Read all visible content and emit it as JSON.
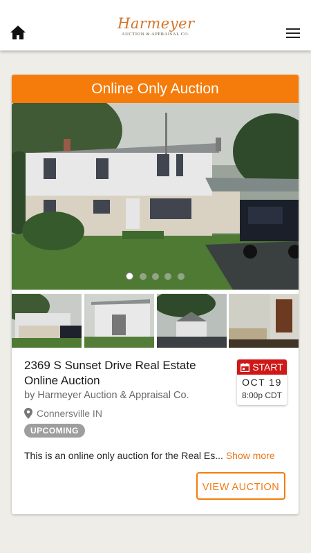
{
  "header": {
    "logo_name": "Harmeyer",
    "logo_sub": "AUCTION & APPRAISAL CO.",
    "home_icon": "home-icon",
    "menu_icon": "hamburger-menu-icon"
  },
  "card": {
    "banner": "Online Only Auction",
    "carousel": {
      "slides": 5,
      "active": 1
    },
    "title": "2369 S Sunset Drive Real Estate Online Auction",
    "org": "by Harmeyer Auction & Appraisal Co.",
    "location": "Connersville IN",
    "status": "UPCOMING",
    "description": "This is an online only auction for the Real Es...",
    "show_more": "Show more",
    "date": {
      "label": "START",
      "day": "OCT 19",
      "time": "8:00p CDT"
    },
    "button": "VIEW AUCTION"
  },
  "colors": {
    "accent": "#f57c0b",
    "date_red": "#d01717",
    "badge_gray": "#9e9e9e"
  }
}
